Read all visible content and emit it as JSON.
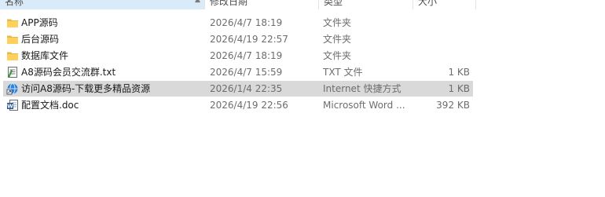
{
  "header": {
    "name_label": "名称",
    "date_label": "修改日期",
    "type_label": "类型",
    "size_label": "大小"
  },
  "files": [
    {
      "name": "APP源码",
      "date": "2026/4/7 18:19",
      "type": "文件夹",
      "size": "",
      "icon": "folder-icon"
    },
    {
      "name": "后台源码",
      "date": "2026/4/19 22:57",
      "type": "文件夹",
      "size": "",
      "icon": "folder-icon"
    },
    {
      "name": "数据库文件",
      "date": "2026/4/7 18:19",
      "type": "文件夹",
      "size": "",
      "icon": "folder-icon"
    },
    {
      "name": "A8源码会员交流群.txt",
      "date": "2026/4/7 15:59",
      "type": "TXT 文件",
      "size": "1 KB",
      "icon": "text-file-icon"
    },
    {
      "name": "访问A8源码-下载更多精品资源",
      "date": "2026/1/4 22:35",
      "type": "Internet 快捷方式",
      "size": "1 KB",
      "icon": "internet-shortcut-icon",
      "selected": true
    },
    {
      "name": "配置文档.doc",
      "date": "2026/4/19 22:56",
      "type": "Microsoft Word ...",
      "size": "392 KB",
      "icon": "word-doc-icon"
    }
  ]
}
